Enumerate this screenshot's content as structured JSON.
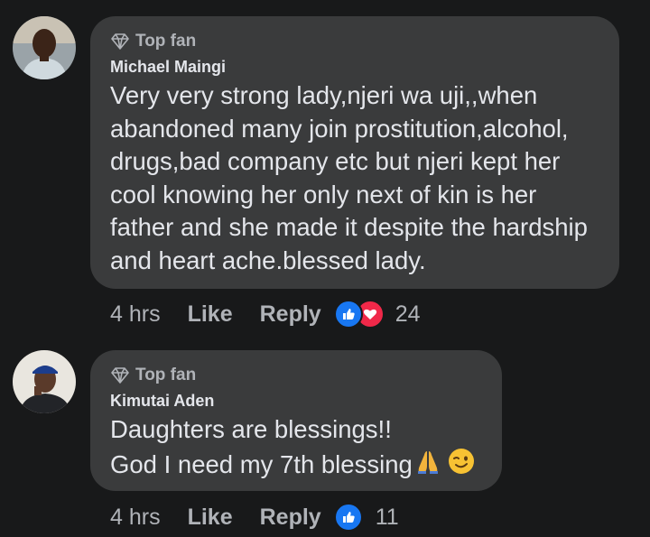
{
  "comments": [
    {
      "badge": "Top fan",
      "author": "Michael Maingi",
      "text": "Very very strong lady,njeri wa uji,,when abandoned many join prostitution,alcohol, drugs,bad company etc  but njeri kept her cool knowing her only next of kin is her father and she made it despite the hardship and heart ache.blessed lady.",
      "time": "4 hrs",
      "like_label": "Like",
      "reply_label": "Reply",
      "reaction_count": "24",
      "reactions": [
        "like-icon",
        "love-icon"
      ]
    },
    {
      "badge": "Top fan",
      "author": "Kimutai Aden",
      "text_line1": "Daughters are blessings!!",
      "text_line2": "God I need my 7th blessing",
      "emojis": [
        "folded-hands-emoji",
        "winking-face-emoji"
      ],
      "time": "4 hrs",
      "like_label": "Like",
      "reply_label": "Reply",
      "reaction_count": "11",
      "reactions": [
        "like-icon"
      ]
    }
  ],
  "colors": {
    "background": "#18191a",
    "bubble": "#3a3b3c",
    "text": "#e4e6eb",
    "secondary_text": "#b0b3b8",
    "like_blue": "#1877f2",
    "love_red": "#f02849"
  }
}
